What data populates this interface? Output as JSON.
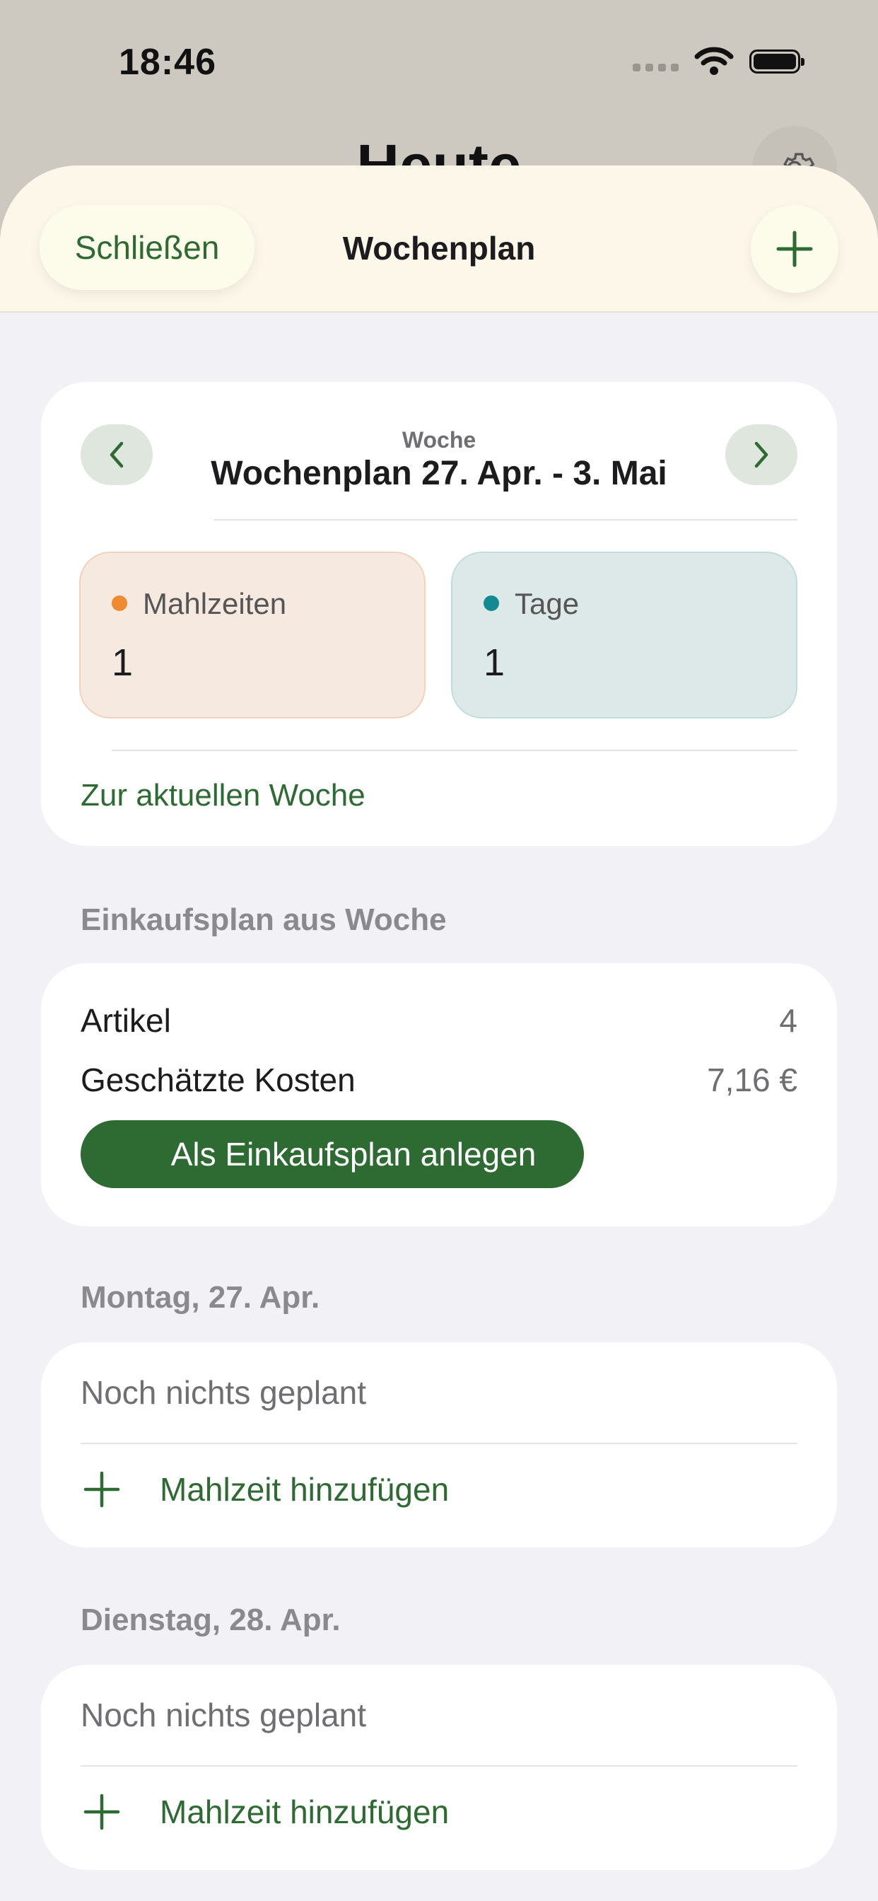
{
  "status_bar": {
    "time": "18:46"
  },
  "background": {
    "title": "Heute",
    "settings_icon": "gear-icon"
  },
  "sheet": {
    "close_label": "Schließen",
    "title": "Wochenplan",
    "add_icon": "plus-icon"
  },
  "week": {
    "label": "Woche",
    "range": "Wochenplan 27. Apr. - 3. Mai",
    "prev_icon": "chevron-left-icon",
    "next_icon": "chevron-right-icon",
    "stats": [
      {
        "label": "Mahlzeiten",
        "value": "1",
        "color": "#f08a30"
      },
      {
        "label": "Tage",
        "value": "1",
        "color": "#138a92"
      }
    ],
    "current_week_link": "Zur aktuellen Woche"
  },
  "shopping": {
    "section_title": "Einkaufsplan aus Woche",
    "rows": [
      {
        "label": "Artikel",
        "value": "4"
      },
      {
        "label": "Geschätzte Kosten",
        "value": "7,16 €"
      }
    ],
    "create_button": "Als Einkaufsplan anlegen"
  },
  "days": [
    {
      "title": "Montag, 27. Apr.",
      "empty": "Noch nichts geplant",
      "add": "Mahlzeit hinzufügen"
    },
    {
      "title": "Dienstag, 28. Apr.",
      "empty": "Noch nichts geplant",
      "add": "Mahlzeit hinzufügen"
    }
  ],
  "colors": {
    "accent": "#2e6b33",
    "sheet_header": "#fdf7ea",
    "background": "#f1f1f6"
  }
}
